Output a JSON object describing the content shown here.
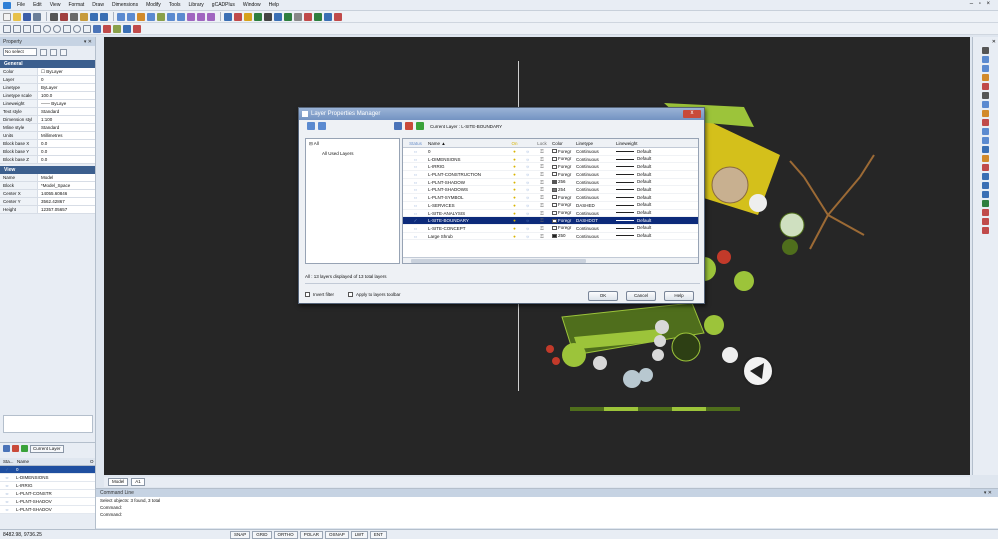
{
  "menubar": {
    "items": [
      "File",
      "Edit",
      "View",
      "Format",
      "Draw",
      "Dimensions",
      "Modify",
      "Tools",
      "Library",
      "gCADPlus",
      "Window",
      "Help"
    ],
    "window_controls": "– ▫ ×"
  },
  "properties": {
    "title": "Property",
    "selection": "No select",
    "general_header": "General",
    "general": [
      {
        "k": "Color",
        "v": "☐ ByLayer"
      },
      {
        "k": "Layer",
        "v": "0"
      },
      {
        "k": "Linetype",
        "v": "ByLayer"
      },
      {
        "k": "Linetype scale",
        "v": "100.0"
      },
      {
        "k": "Lineweight",
        "v": "—— ByLaye"
      },
      {
        "k": "Text style",
        "v": "Standard"
      },
      {
        "k": "Dimension styl",
        "v": "1:100"
      },
      {
        "k": "Mline style",
        "v": "Standard"
      },
      {
        "k": "Units",
        "v": "Millimetres"
      },
      {
        "k": "Block base X",
        "v": "0.0"
      },
      {
        "k": "Block base Y",
        "v": "0.0"
      },
      {
        "k": "Block base Z",
        "v": "0.0"
      }
    ],
    "view_header": "View",
    "view": [
      {
        "k": "Name",
        "v": "Model"
      },
      {
        "k": "Block",
        "v": "*Model_Space"
      },
      {
        "k": "Center X",
        "v": "14055.60846"
      },
      {
        "k": "Center Y",
        "v": "3562.42867"
      },
      {
        "k": "Height",
        "v": "12357.05657"
      }
    ]
  },
  "layer_mini": {
    "current_label": "Current Layer",
    "col_status": "Sta...",
    "col_name": "Name",
    "col_on": "O",
    "rows": [
      {
        "st": "✓",
        "nm": "0",
        "sel": true
      },
      {
        "st": "⇔",
        "nm": "L-DIMENSIONS"
      },
      {
        "st": "⇔",
        "nm": "L-IRRIG"
      },
      {
        "st": "⇔",
        "nm": "L-PLNT-CONSTR"
      },
      {
        "st": "⇔",
        "nm": "L-PLNT-SHADOV"
      },
      {
        "st": "⇔",
        "nm": "L-PLNT-SHADOV"
      }
    ]
  },
  "dialog": {
    "title": "Layer Properties Manager",
    "close": "x",
    "current_layer": "Current Layer : L-SITE-BOUNDARY",
    "tree_root": "All",
    "tree_child": "All Used Layers",
    "columns": {
      "status": "Status",
      "name": "Name ▲",
      "on": "On",
      "lock": "Lock",
      "color": "Color",
      "linetype": "Linetype",
      "lineweight": "Lineweight"
    },
    "rows": [
      {
        "status": "⇔",
        "name": "0",
        "on": "💡",
        "lock": "🔓",
        "color": "Foregr",
        "sw": "#ffffff",
        "linetype": "Continuous",
        "lw": "Default"
      },
      {
        "status": "⇔",
        "name": "L-DIMENSIONS",
        "on": "💡",
        "lock": "🔓",
        "color": "Foregr",
        "sw": "#ffffff",
        "linetype": "Continuous",
        "lw": "Default"
      },
      {
        "status": "⇔",
        "name": "L-IRRIG",
        "on": "💡",
        "lock": "🔓",
        "color": "Foregr",
        "sw": "#ffffff",
        "linetype": "Continuous",
        "lw": "Default"
      },
      {
        "status": "⇔",
        "name": "L-PLNT-CONSTRUCTION",
        "on": "💡",
        "lock": "🔓",
        "color": "Foregr",
        "sw": "#ffffff",
        "linetype": "Continuous",
        "lw": "Default"
      },
      {
        "status": "⇔",
        "name": "L-PLNT-SHADOW",
        "on": "💡",
        "lock": "🔓",
        "color": "256",
        "sw": "#555555",
        "linetype": "Continuous",
        "lw": "Default"
      },
      {
        "status": "⇔",
        "name": "L-PLNT-SHADOWS",
        "on": "💡",
        "lock": "🔓",
        "color": "254",
        "sw": "#777777",
        "linetype": "Continuous",
        "lw": "Default"
      },
      {
        "status": "⇔",
        "name": "L-PLNT-SYMBOL",
        "on": "💡",
        "lock": "🔓",
        "color": "Foregr",
        "sw": "#ffffff",
        "linetype": "Continuous",
        "lw": "Default"
      },
      {
        "status": "⇔",
        "name": "L-SERVICES",
        "on": "💡",
        "lock": "🔓",
        "color": "Foregr",
        "sw": "#ffffff",
        "linetype": "DASHED",
        "lw": "Default"
      },
      {
        "status": "⇔",
        "name": "L-SITE-ANALYSIS",
        "on": "💡",
        "lock": "🔓",
        "color": "Foregr",
        "sw": "#ffffff",
        "linetype": "Continuous",
        "lw": "Default"
      },
      {
        "status": "✓",
        "name": "L-SITE-BOUNDARY",
        "on": "💡",
        "lock": "🔓",
        "color": "Foregr",
        "sw": "#ffffff",
        "linetype": "DASHDOT",
        "lw": "Default",
        "sel": true
      },
      {
        "status": "⇔",
        "name": "L-SITE-CONCEPT",
        "on": "💡",
        "lock": "🔓",
        "color": "Foregr",
        "sw": "#ffffff",
        "linetype": "Continuous",
        "lw": "Default"
      },
      {
        "status": "⇔",
        "name": "Large Shrub",
        "on": "💡",
        "lock": "🔓",
        "color": "250",
        "sw": "#222222",
        "linetype": "Continuous",
        "lw": "Default"
      }
    ],
    "summary": "All : 13 layers displayed of 13 total layers",
    "invert_filter": "Invert filter",
    "apply_toolbar": "Apply to layers toolbar",
    "ok": "OK",
    "cancel": "Cancel",
    "help": "Help"
  },
  "tabs": {
    "model": "Model",
    "layout": "A1"
  },
  "command": {
    "title": "Command Line",
    "lines": [
      "Select objects: 3 found, 3 total",
      "Command:",
      "Command:"
    ]
  },
  "status": {
    "coords": "8482.98, 9736.25",
    "buttons": [
      "SNAP",
      "GRID",
      "ORTHO",
      "POLAR",
      "OSNAP",
      "LWT",
      "ENT"
    ]
  },
  "colors": {
    "canvas": "#262626",
    "plant_green": "#9cc43a",
    "dark_green": "#4f6e1c",
    "yellow": "#e8d21b",
    "brown": "#9c6a35"
  }
}
